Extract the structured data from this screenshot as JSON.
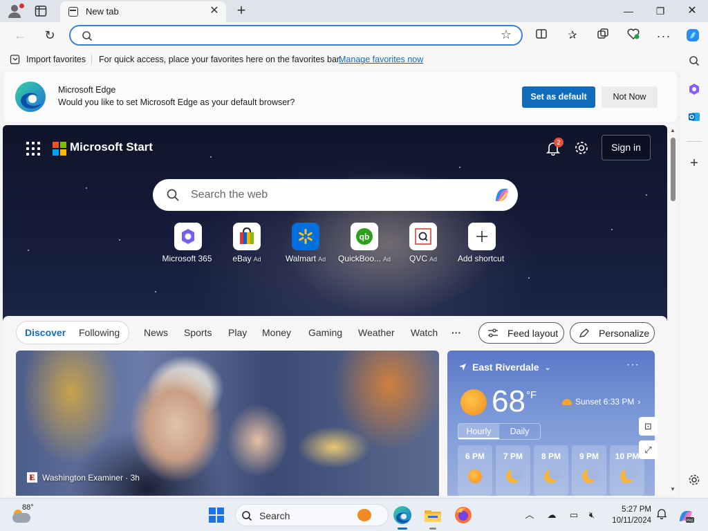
{
  "browser": {
    "tab_title": "New tab",
    "address_placeholder": ""
  },
  "favorites_bar": {
    "import_label": "Import favorites",
    "hint": "For quick access, place your favorites here on the favorites bar.",
    "manage_link": "Manage favorites now"
  },
  "default_banner": {
    "title": "Microsoft Edge",
    "message": "Would you like to set Microsoft Edge as your default browser?",
    "primary_button": "Set as default",
    "secondary_button": "Not Now"
  },
  "ntp": {
    "brand": "Microsoft Start",
    "notification_count": "2",
    "sign_in": "Sign in",
    "search_placeholder": "Search the web",
    "shortcuts": [
      {
        "label": "Microsoft 365",
        "ad": ""
      },
      {
        "label": "eBay",
        "ad": "Ad"
      },
      {
        "label": "Walmart",
        "ad": "Ad"
      },
      {
        "label": "QuickBoo...",
        "ad": "Ad"
      },
      {
        "label": "QVC",
        "ad": "Ad"
      },
      {
        "label": "Add shortcut",
        "ad": ""
      }
    ]
  },
  "feed": {
    "tabs": {
      "discover": "Discover",
      "following": "Following"
    },
    "categories": [
      "News",
      "Sports",
      "Play",
      "Money",
      "Gaming",
      "Weather",
      "Watch"
    ],
    "more": "···",
    "feed_layout": "Feed layout",
    "personalize": "Personalize",
    "hero": {
      "source": "Washington Examiner · 3h",
      "source_logo": "E"
    }
  },
  "weather": {
    "location": "East Riverdale",
    "temp": "68",
    "unit": "°F",
    "sunset": "Sunset 6:33 PM",
    "tabs": [
      "Hourly",
      "Daily"
    ],
    "hours": [
      {
        "time": "6 PM",
        "icon": "sun"
      },
      {
        "time": "7 PM",
        "icon": "moon"
      },
      {
        "time": "8 PM",
        "icon": "moon"
      },
      {
        "time": "9 PM",
        "icon": "moon"
      },
      {
        "time": "10 PM",
        "icon": "moon"
      }
    ]
  },
  "taskbar": {
    "weather_temp": "88°",
    "search_label": "Search",
    "time": "5:27 PM",
    "date": "10/11/2024"
  },
  "colors": {
    "accent": "#0f6cbd",
    "banner_primary": "#0f6cbd",
    "weather_card": "#6f8ed6"
  }
}
